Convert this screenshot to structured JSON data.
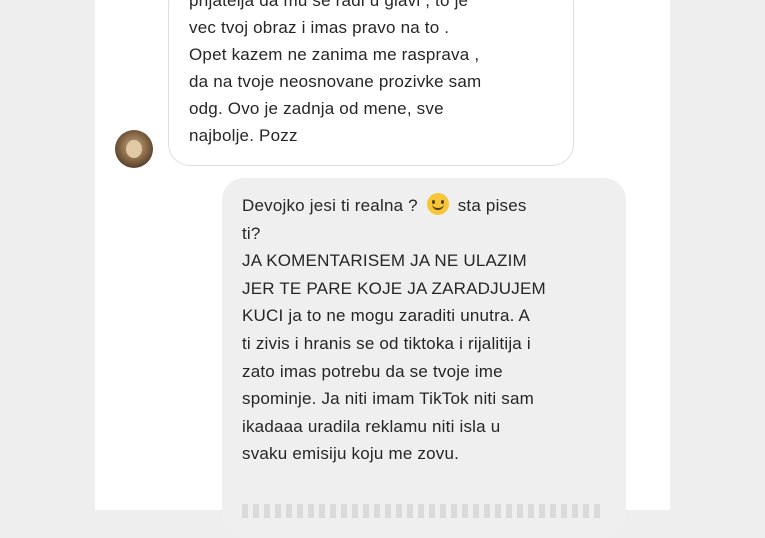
{
  "thread": {
    "received_message": {
      "lines": [
        "prijatelja da mu se radi u glavi , to je",
        "vec tvoj obraz i imas pravo na to .",
        "Opet kazem ne zanima me rasprava ,",
        "da na tvoje neosnovane prozivke sam",
        "odg. Ovo je zadnja od mene, sve",
        "najbolje. Pozz"
      ]
    },
    "sent_message": {
      "line1_before_emoji": "Devojko jesi ti realna ?",
      "emoji_icon": "slightly-smiling-face-emoji",
      "line1_after_emoji": "sta pises",
      "lines": [
        "ti?",
        "JA KOMENTARISEM JA NE ULAZIM",
        "JER TE PARE KOJE JA ZARADJUJEM",
        "KUCI ja to ne mogu zaraditi unutra. A",
        "ti zivis i hranis se od tiktoka i rijalitija i",
        "zato imas potrebu da se tvoje ime",
        "spominje. Ja niti imam TikTok niti sam",
        "ikadaaa uradila reklamu niti isla u",
        "svaku emisiju koju me zovu."
      ]
    }
  },
  "colors": {
    "received_bubble": "#ffffff",
    "sent_bubble": "#efefef",
    "text": "#262626"
  }
}
